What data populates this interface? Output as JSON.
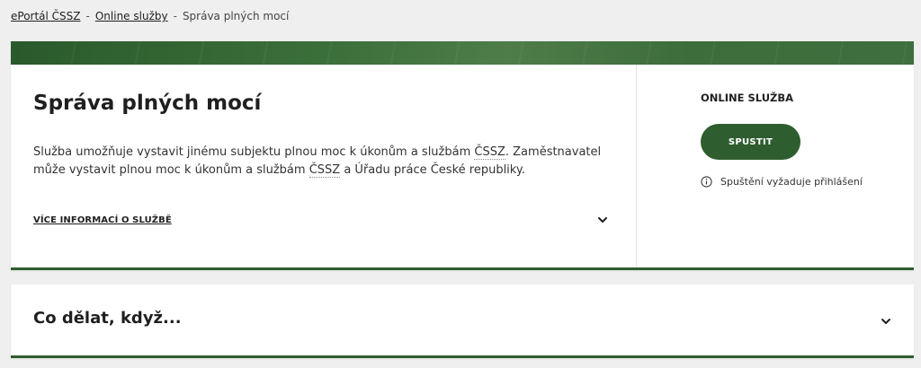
{
  "breadcrumb": {
    "items": [
      "ePortál ČSSZ",
      "Online služby"
    ],
    "separator": "-",
    "current": "Správa plných mocí"
  },
  "service": {
    "title": "Správa plných mocí",
    "desc_part1": "Služba umožňuje vystavit jinému subjektu plnou moc k úkonům a službám ",
    "abbr1": "ČSSZ",
    "desc_part2": ". Zaměstnavatel může vystavit plnou moc k úkonům a službám ",
    "abbr2": "ČSSZ",
    "desc_part3": " a Úřadu práce České republiky.",
    "more_info_label": "VÍCE INFORMACÍ O SLUŽBĚ"
  },
  "online": {
    "label": "ONLINE SLUŽBA",
    "start_button": "SPUSTIT",
    "login_note": "Spuštění vyžaduje přihlášení"
  },
  "faq": {
    "title": "Co dělat, když..."
  },
  "icons": {
    "chevron": "chevron-down-icon",
    "info": "info-icon"
  },
  "colors": {
    "accent": "#2e5e2f",
    "background": "#efefef"
  }
}
